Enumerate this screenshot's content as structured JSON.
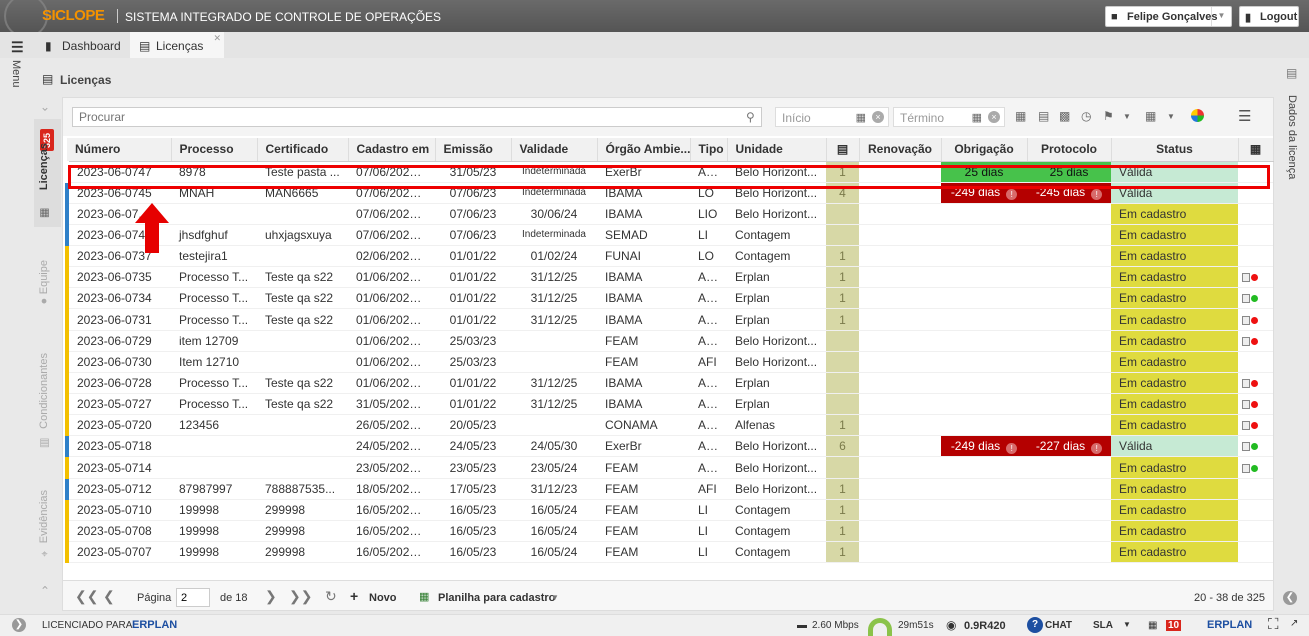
{
  "app": {
    "logo": "SICLOPE",
    "title": "SISTEMA INTEGRADO DE CONTROLE DE OPERAÇÕES"
  },
  "user": {
    "name": "Felipe Gonçalves",
    "logout_label": "Logout"
  },
  "tabs": [
    {
      "label": "Dashboard"
    },
    {
      "label": "Licenças"
    }
  ],
  "menu_label": "Menu",
  "page": {
    "title": "Licenças"
  },
  "sidebar": {
    "licencas_label": "Licenças",
    "licencas_badge": "325",
    "equipe_label": "Equipe",
    "condicionantes_label": "Condicionantes",
    "evidencias_label": "Evidências"
  },
  "right_panel_label": "Dados da licença",
  "toolbar": {
    "search_placeholder": "Procurar",
    "start_placeholder": "Início",
    "end_placeholder": "Término"
  },
  "columns": [
    "Número",
    "Processo",
    "Certificado",
    "Cadastro em",
    "Emissão",
    "Validade",
    "Órgão Ambie...",
    "Tipo",
    "Unidade",
    "",
    "Renovação",
    "Obrigação",
    "Protocolo",
    "Status",
    ""
  ],
  "rows": [
    {
      "numero": "2023-06-0747",
      "processo": "8978",
      "certificado": "Teste pasta ...",
      "cadastro": "07/06/2023 1...",
      "emissao": "31/05/23",
      "validade": "Indeterminada",
      "orgao": "ExerBr",
      "tipo": "AL...",
      "unidade": "Belo Horizont...",
      "qty": "1",
      "obrigacao": "25 dias",
      "protocolo": "25 dias",
      "status": "Válida",
      "bar": "none",
      "ob_state": "ok",
      "pr_state": "ok",
      "flag": ""
    },
    {
      "numero": "2023-06-0745",
      "processo": "MNAH",
      "certificado": "MAN6665",
      "cadastro": "07/06/2023 1...",
      "emissao": "07/06/23",
      "validade": "Indeterminada",
      "orgao": "IBAMA",
      "tipo": "LO",
      "unidade": "Belo Horizont...",
      "qty": "4",
      "obrigacao": "-249 dias",
      "protocolo": "-245 dias",
      "status": "Válida",
      "bar": "blue",
      "ob_state": "bad",
      "pr_state": "bad",
      "flag": ""
    },
    {
      "numero": "2023-06-07...",
      "processo": "",
      "certificado": "",
      "cadastro": "07/06/2023 1...",
      "emissao": "07/06/23",
      "validade": "30/06/24",
      "orgao": "IBAMA",
      "tipo": "LIO",
      "unidade": "Belo Horizont...",
      "qty": "",
      "obrigacao": "",
      "protocolo": "",
      "status": "Em cadastro",
      "bar": "blue",
      "ob_state": "",
      "pr_state": "",
      "flag": ""
    },
    {
      "numero": "2023-06-074...",
      "processo": "jhsdfghuf",
      "certificado": "uhxjagsxuya",
      "cadastro": "07/06/2023 1...",
      "emissao": "07/06/23",
      "validade": "Indeterminada",
      "orgao": "SEMAD",
      "tipo": "LI",
      "unidade": "Contagem",
      "qty": "",
      "obrigacao": "",
      "protocolo": "",
      "status": "Em cadastro",
      "bar": "blue",
      "ob_state": "",
      "pr_state": "",
      "flag": ""
    },
    {
      "numero": "2023-06-0737",
      "processo": "testejira1",
      "certificado": "",
      "cadastro": "02/06/2023 0...",
      "emissao": "01/01/22",
      "validade": "01/02/24",
      "orgao": "FUNAI",
      "tipo": "LO",
      "unidade": "Contagem",
      "qty": "1",
      "obrigacao": "",
      "protocolo": "",
      "status": "Em cadastro",
      "bar": "yellow",
      "ob_state": "",
      "pr_state": "",
      "flag": ""
    },
    {
      "numero": "2023-06-0735",
      "processo": "Processo T...",
      "certificado": "Teste qa s22",
      "cadastro": "01/06/2023 1...",
      "emissao": "01/01/22",
      "validade": "31/12/25",
      "orgao": "IBAMA",
      "tipo": "AL...",
      "unidade": "Erplan",
      "qty": "1",
      "obrigacao": "",
      "protocolo": "",
      "status": "Em cadastro",
      "bar": "yellow",
      "ob_state": "",
      "pr_state": "",
      "flag": "red"
    },
    {
      "numero": "2023-06-0734",
      "processo": "Processo T...",
      "certificado": "Teste qa s22",
      "cadastro": "01/06/2023 1...",
      "emissao": "01/01/22",
      "validade": "31/12/25",
      "orgao": "IBAMA",
      "tipo": "AL...",
      "unidade": "Erplan",
      "qty": "1",
      "obrigacao": "",
      "protocolo": "",
      "status": "Em cadastro",
      "bar": "yellow",
      "ob_state": "",
      "pr_state": "",
      "flag": "green"
    },
    {
      "numero": "2023-06-0731",
      "processo": "Processo T...",
      "certificado": "Teste qa s22",
      "cadastro": "01/06/2023 1...",
      "emissao": "01/01/22",
      "validade": "31/12/25",
      "orgao": "IBAMA",
      "tipo": "AL...",
      "unidade": "Erplan",
      "qty": "1",
      "obrigacao": "",
      "protocolo": "",
      "status": "Em cadastro",
      "bar": "yellow",
      "ob_state": "",
      "pr_state": "",
      "flag": "red"
    },
    {
      "numero": "2023-06-0729",
      "processo": "item 12709",
      "certificado": "",
      "cadastro": "01/06/2023 1...",
      "emissao": "25/03/23",
      "validade": "",
      "orgao": "FEAM",
      "tipo": "AL...",
      "unidade": "Belo Horizont...",
      "qty": "",
      "obrigacao": "",
      "protocolo": "",
      "status": "Em cadastro",
      "bar": "yellow",
      "ob_state": "",
      "pr_state": "",
      "flag": "red"
    },
    {
      "numero": "2023-06-0730",
      "processo": "Item 12710",
      "certificado": "",
      "cadastro": "01/06/2023 1...",
      "emissao": "25/03/23",
      "validade": "",
      "orgao": "FEAM",
      "tipo": "AFI",
      "unidade": "Belo Horizont...",
      "qty": "",
      "obrigacao": "",
      "protocolo": "",
      "status": "Em cadastro",
      "bar": "yellow",
      "ob_state": "",
      "pr_state": "",
      "flag": ""
    },
    {
      "numero": "2023-06-0728",
      "processo": "Processo T...",
      "certificado": "Teste qa s22",
      "cadastro": "01/06/2023 1...",
      "emissao": "01/01/22",
      "validade": "31/12/25",
      "orgao": "IBAMA",
      "tipo": "AL...",
      "unidade": "Erplan",
      "qty": "",
      "obrigacao": "",
      "protocolo": "",
      "status": "Em cadastro",
      "bar": "yellow",
      "ob_state": "",
      "pr_state": "",
      "flag": "red"
    },
    {
      "numero": "2023-05-0727",
      "processo": "Processo T...",
      "certificado": "Teste qa s22",
      "cadastro": "31/05/2023 0...",
      "emissao": "01/01/22",
      "validade": "31/12/25",
      "orgao": "IBAMA",
      "tipo": "AL...",
      "unidade": "Erplan",
      "qty": "",
      "obrigacao": "",
      "protocolo": "",
      "status": "Em cadastro",
      "bar": "yellow",
      "ob_state": "",
      "pr_state": "",
      "flag": "red"
    },
    {
      "numero": "2023-05-0720",
      "processo": "123456",
      "certificado": "",
      "cadastro": "26/05/2023 1...",
      "emissao": "20/05/23",
      "validade": "",
      "orgao": "CONAMA",
      "tipo": "AL...",
      "unidade": "Alfenas",
      "qty": "1",
      "obrigacao": "",
      "protocolo": "",
      "status": "Em cadastro",
      "bar": "yellow",
      "ob_state": "",
      "pr_state": "",
      "flag": "red"
    },
    {
      "numero": "2023-05-0718",
      "processo": "",
      "certificado": "",
      "cadastro": "24/05/2023 1...",
      "emissao": "24/05/23",
      "validade": "24/05/30",
      "orgao": "ExerBr",
      "tipo": "AU...",
      "unidade": "Belo Horizont...",
      "qty": "6",
      "obrigacao": "-249 dias",
      "protocolo": "-227 dias",
      "status": "Válida",
      "bar": "blue",
      "ob_state": "bad",
      "pr_state": "bad",
      "flag": "green"
    },
    {
      "numero": "2023-05-0714",
      "processo": "",
      "certificado": "",
      "cadastro": "23/05/2023 1...",
      "emissao": "23/05/23",
      "validade": "23/05/24",
      "orgao": "FEAM",
      "tipo": "AU...",
      "unidade": "Belo Horizont...",
      "qty": "",
      "obrigacao": "",
      "protocolo": "",
      "status": "Em cadastro",
      "bar": "yellow",
      "ob_state": "",
      "pr_state": "",
      "flag": "green"
    },
    {
      "numero": "2023-05-0712",
      "processo": "87987997",
      "certificado": "788887535...",
      "cadastro": "18/05/2023 1...",
      "emissao": "17/05/23",
      "validade": "31/12/23",
      "orgao": "FEAM",
      "tipo": "AFI",
      "unidade": "Belo Horizont...",
      "qty": "1",
      "obrigacao": "",
      "protocolo": "",
      "status": "Em cadastro",
      "bar": "blue",
      "ob_state": "",
      "pr_state": "",
      "flag": ""
    },
    {
      "numero": "2023-05-0710",
      "processo": "199998",
      "certificado": "299998",
      "cadastro": "16/05/2023 1...",
      "emissao": "16/05/23",
      "validade": "16/05/24",
      "orgao": "FEAM",
      "tipo": "LI",
      "unidade": "Contagem",
      "qty": "1",
      "obrigacao": "",
      "protocolo": "",
      "status": "Em cadastro",
      "bar": "yellow",
      "ob_state": "",
      "pr_state": "",
      "flag": ""
    },
    {
      "numero": "2023-05-0708",
      "processo": "199998",
      "certificado": "299998",
      "cadastro": "16/05/2023 1...",
      "emissao": "16/05/23",
      "validade": "16/05/24",
      "orgao": "FEAM",
      "tipo": "LI",
      "unidade": "Contagem",
      "qty": "1",
      "obrigacao": "",
      "protocolo": "",
      "status": "Em cadastro",
      "bar": "yellow",
      "ob_state": "",
      "pr_state": "",
      "flag": ""
    },
    {
      "numero": "2023-05-0707",
      "processo": "199998",
      "certificado": "299998",
      "cadastro": "16/05/2023 1...",
      "emissao": "16/05/23",
      "validade": "16/05/24",
      "orgao": "FEAM",
      "tipo": "LI",
      "unidade": "Contagem",
      "qty": "1",
      "obrigacao": "",
      "protocolo": "",
      "status": "Em cadastro",
      "bar": "yellow",
      "ob_state": "",
      "pr_state": "",
      "flag": ""
    }
  ],
  "pager": {
    "page_label": "Página",
    "page_value": "2",
    "of_label": "de 18",
    "new_label": "Novo",
    "sheet_label": "Planilha para cadastro",
    "count": "20 - 38 de 325"
  },
  "statusbar": {
    "license_label": "LICENCIADO PARA:",
    "brand": "ERPLAN",
    "speed": "2.60 Mbps",
    "timer": "29m51s",
    "version": "0.9R420",
    "chat": "CHAT",
    "sla": "SLA",
    "notif": "10"
  },
  "colors": {
    "valid_bg": "#c6ead4",
    "cadastro_bg": "#dfdb3f",
    "ok_green": "#47c24b",
    "bad_red": "#b40000",
    "highlight": "#e00000"
  }
}
